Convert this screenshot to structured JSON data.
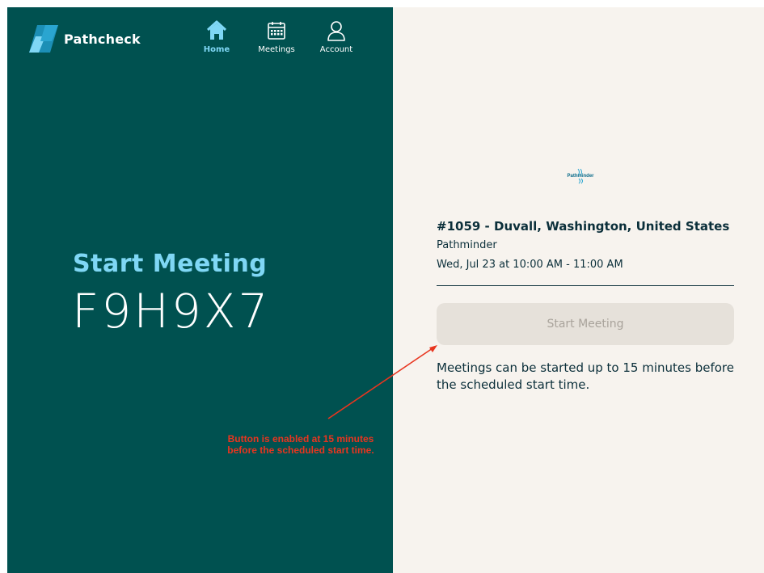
{
  "app": {
    "name": "Pathcheck"
  },
  "nav": {
    "items": [
      {
        "label": "Home",
        "icon": "home-icon",
        "active": true
      },
      {
        "label": "Meetings",
        "icon": "calendar-icon",
        "active": false
      },
      {
        "label": "Account",
        "icon": "user-icon",
        "active": false
      }
    ]
  },
  "hero": {
    "title": "Start Meeting",
    "code": "F9H9X7"
  },
  "meeting": {
    "partner_logo_text": "Pathminder",
    "title": "#1059 - Duvall, Washington, United States",
    "organization": "Pathminder",
    "time": "Wed, Jul 23 at 10:00 AM - 11:00 AM",
    "start_button_label": "Start Meeting",
    "start_button_enabled": false,
    "info": "Meetings can be started up to 15 minutes before the scheduled start time."
  },
  "annotation": {
    "text": "Button is enabled at 15 minutes before the scheduled start time."
  },
  "colors": {
    "left_panel": "#005150",
    "right_panel": "#f7f3ee",
    "accent": "#7fd7f5",
    "annotation": "#e8351f",
    "text_dark": "#0b2f3a"
  }
}
